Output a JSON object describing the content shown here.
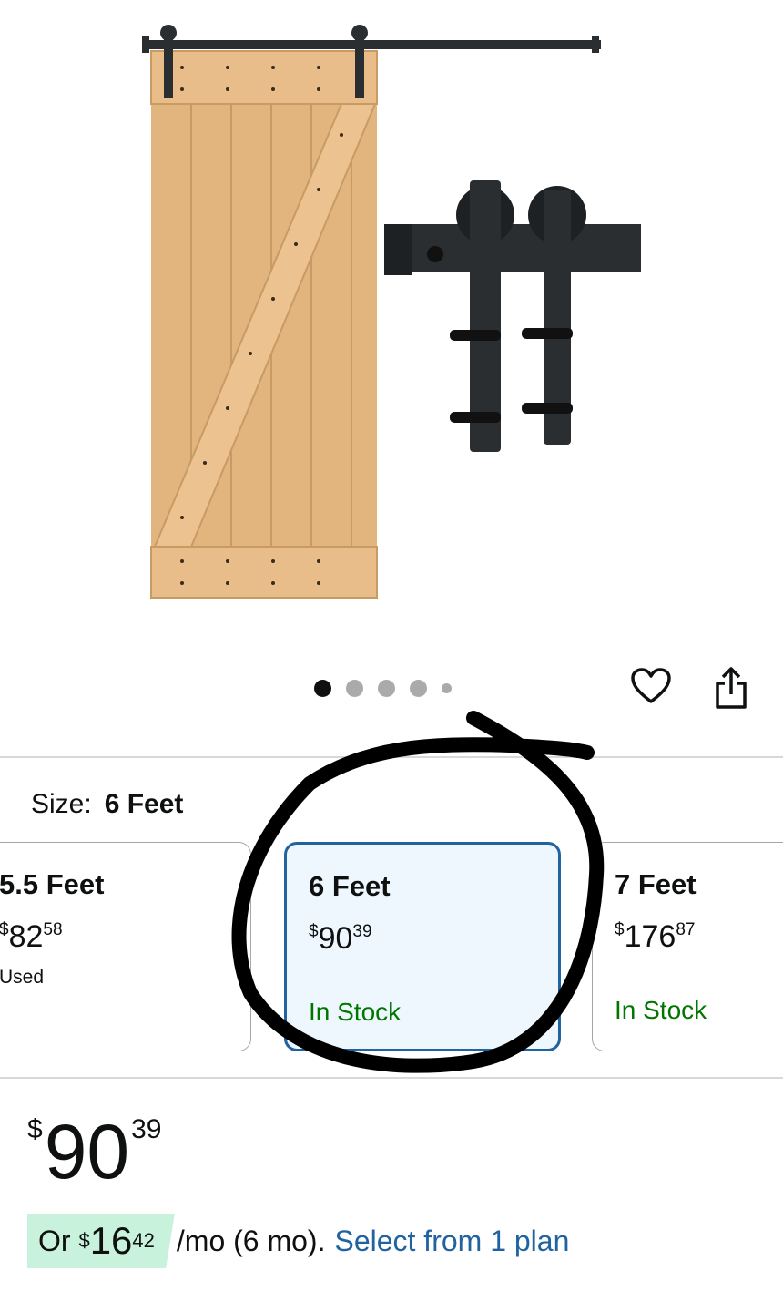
{
  "colors": {
    "selected_border": "#2162a1",
    "selected_bg": "#edf7fd",
    "in_stock": "#007600",
    "link": "#2162a1",
    "installment_bg": "#c9f2dd",
    "wood": "#e3b884",
    "hardware": "#1e2224"
  },
  "carousel": {
    "count": 5,
    "active_index": 0
  },
  "icons": {
    "wishlist": "heart-icon",
    "share": "share-icon"
  },
  "size": {
    "label": "Size:",
    "selected": "6 Feet"
  },
  "options": [
    {
      "name": "5.5 Feet",
      "currency": "$",
      "whole": "82",
      "cents": "58",
      "condition": "Used",
      "stock": ""
    },
    {
      "name": "6 Feet",
      "currency": "$",
      "whole": "90",
      "cents": "39",
      "condition": "",
      "stock": "In Stock"
    },
    {
      "name": "7 Feet",
      "currency": "$",
      "whole": "176",
      "cents": "87",
      "condition": "",
      "stock": "In Stock"
    }
  ],
  "price": {
    "currency": "$",
    "whole": "90",
    "cents": "39"
  },
  "installment": {
    "prefix": "Or",
    "currency": "$",
    "whole": "16",
    "cents": "42",
    "suffix": "/mo (6 mo).",
    "link": "Select from 1 plan"
  }
}
